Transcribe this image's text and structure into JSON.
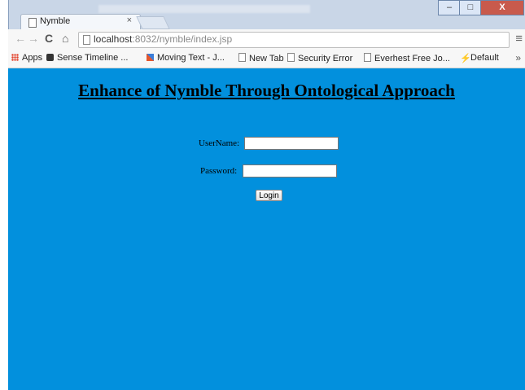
{
  "window": {
    "tab_title": "Nymble",
    "tab_close": "×",
    "controls": {
      "minimize": "–",
      "maximize": "□",
      "close": "X"
    }
  },
  "toolbar": {
    "back": "←",
    "forward": "→",
    "reload": "C",
    "home": "⌂",
    "url_host": "localhost",
    "url_path": ":8032/nymble/index.jsp",
    "menu": "≡"
  },
  "bookmarks": {
    "items": [
      {
        "label": "Apps",
        "icon": "apps-icon"
      },
      {
        "label": "Sense Timeline ...",
        "icon": "sense-icon"
      },
      {
        "label": "Moving Text - J...",
        "icon": "moving-text-icon"
      },
      {
        "label": "New Tab",
        "icon": "page-icon"
      },
      {
        "label": "Security Error",
        "icon": "page-icon"
      },
      {
        "label": "Everhest Free Jo...",
        "icon": "page-icon"
      },
      {
        "label": "Default",
        "icon": "default-icon"
      }
    ],
    "more": "»"
  },
  "page": {
    "background": "#0290dd",
    "heading": "Enhance of Nymble Through Ontological Approach",
    "username_label": "UserName:",
    "username_value": "",
    "password_label": "Password:",
    "password_value": "",
    "login_label": "Login"
  }
}
